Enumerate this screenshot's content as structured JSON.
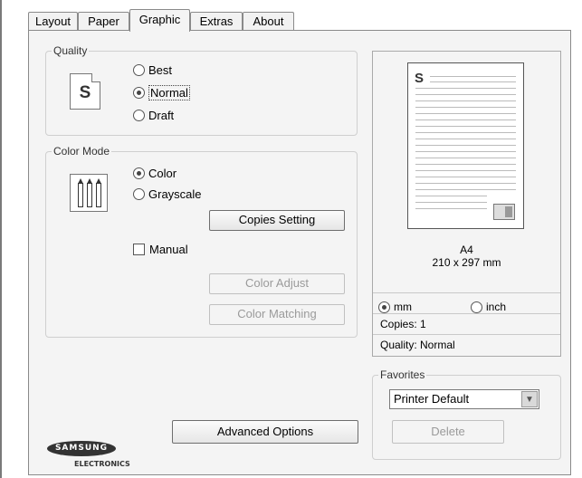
{
  "tabs": [
    "Layout",
    "Paper",
    "Graphic",
    "Extras",
    "About"
  ],
  "active_tab": "Graphic",
  "quality": {
    "label": "Quality",
    "options": [
      "Best",
      "Normal",
      "Draft"
    ],
    "selected": "Normal"
  },
  "color_mode": {
    "label": "Color Mode",
    "options": [
      "Color",
      "Grayscale"
    ],
    "selected": "Color",
    "copies_setting_button": "Copies Setting",
    "manual_label": "Manual",
    "manual_checked": false,
    "color_adjust_button": "Color Adjust",
    "color_matching_button": "Color Matching"
  },
  "preview": {
    "paper_letter": "S",
    "paper_name": "A4",
    "paper_size": "210 x 297 mm",
    "units": [
      "mm",
      "inch"
    ],
    "selected_unit": "mm",
    "copies": "Copies: 1",
    "quality": "Quality: Normal"
  },
  "favorites": {
    "label": "Favorites",
    "selected": "Printer Default",
    "delete_button": "Delete"
  },
  "advanced_options_button": "Advanced Options",
  "logo": {
    "brand": "SAMSUNG",
    "sub": "ELECTRONICS"
  }
}
